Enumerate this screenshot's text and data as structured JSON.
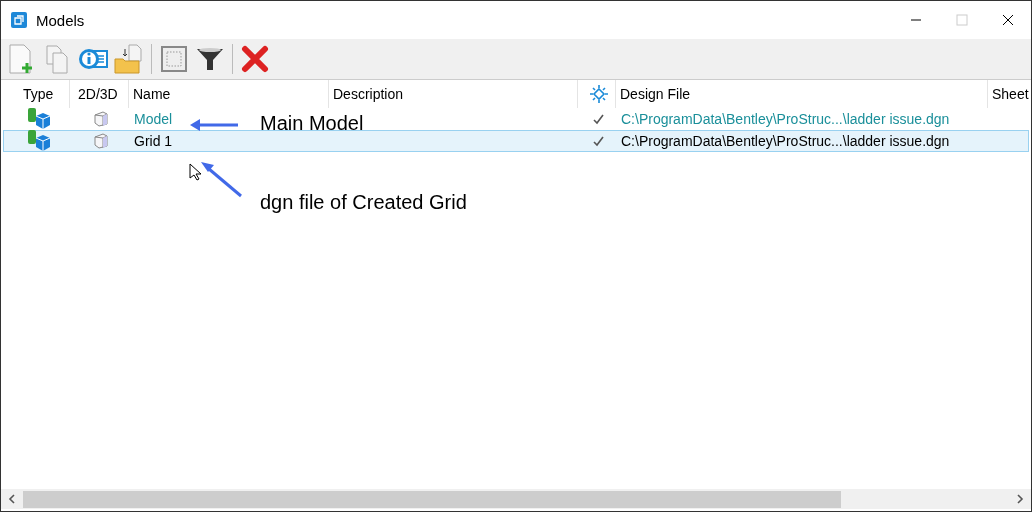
{
  "window": {
    "title": "Models"
  },
  "table": {
    "columns": [
      "Type",
      "2D/3D",
      "Name",
      "Description",
      "Design File",
      "Sheet"
    ],
    "rows": [
      {
        "name": "Model",
        "design_file": "C:\\ProgramData\\Bentley\\ProStruc...\\ladder issue.dgn",
        "active": true,
        "selected": false
      },
      {
        "name": "Grid 1",
        "design_file": "C:\\ProgramData\\Bentley\\ProStruc...\\ladder issue.dgn",
        "active": false,
        "selected": true
      }
    ]
  },
  "annotations": [
    "Main Model",
    "dgn file of Created Grid"
  ]
}
